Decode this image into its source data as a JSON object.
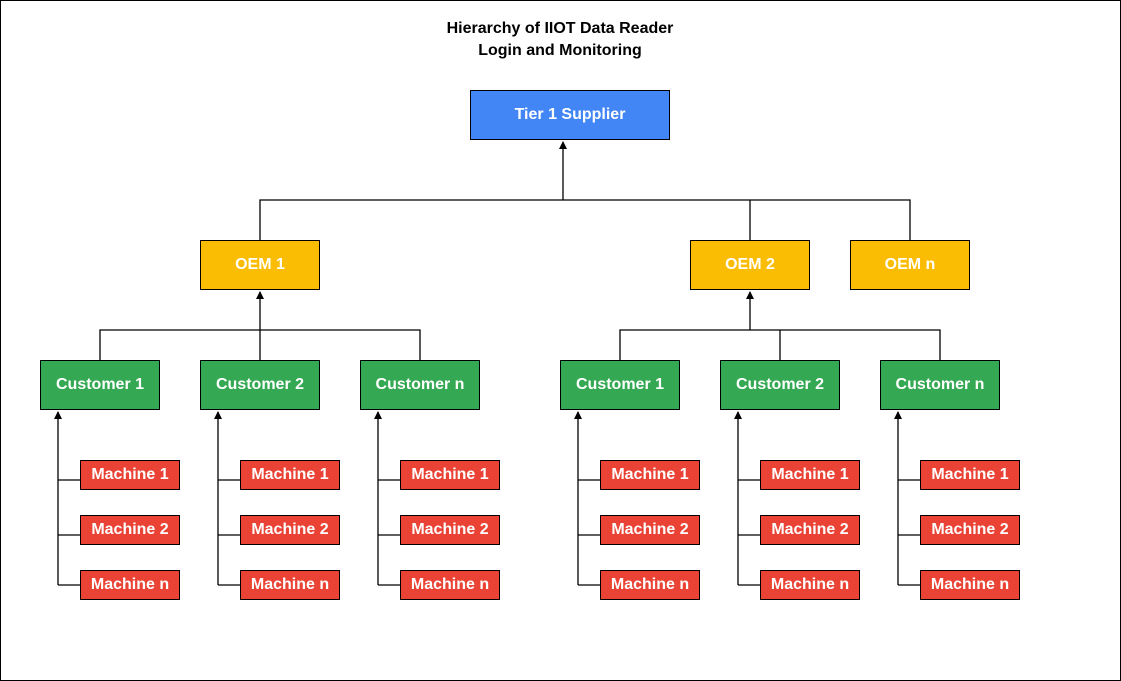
{
  "title": {
    "line1": "Hierarchy of IIOT Data Reader",
    "line2": "Login and Monitoring"
  },
  "colors": {
    "supplier": "#4285f4",
    "oem": "#fbbc04",
    "customer": "#34a853",
    "machine": "#ea4335"
  },
  "supplier": {
    "label": "Tier 1 Supplier"
  },
  "oems": [
    {
      "label": "OEM 1",
      "customers": [
        {
          "label": "Customer 1",
          "machines": [
            "Machine 1",
            "Machine 2",
            "Machine n"
          ]
        },
        {
          "label": "Customer 2",
          "machines": [
            "Machine 1",
            "Machine 2",
            "Machine n"
          ]
        },
        {
          "label": "Customer n",
          "machines": [
            "Machine 1",
            "Machine 2",
            "Machine n"
          ]
        }
      ]
    },
    {
      "label": "OEM 2",
      "customers": [
        {
          "label": "Customer 1",
          "machines": [
            "Machine 1",
            "Machine 2",
            "Machine n"
          ]
        },
        {
          "label": "Customer 2",
          "machines": [
            "Machine 1",
            "Machine 2",
            "Machine n"
          ]
        },
        {
          "label": "Customer n",
          "machines": [
            "Machine 1",
            "Machine 2",
            "Machine n"
          ]
        }
      ]
    },
    {
      "label": "OEM n",
      "customers": []
    }
  ]
}
